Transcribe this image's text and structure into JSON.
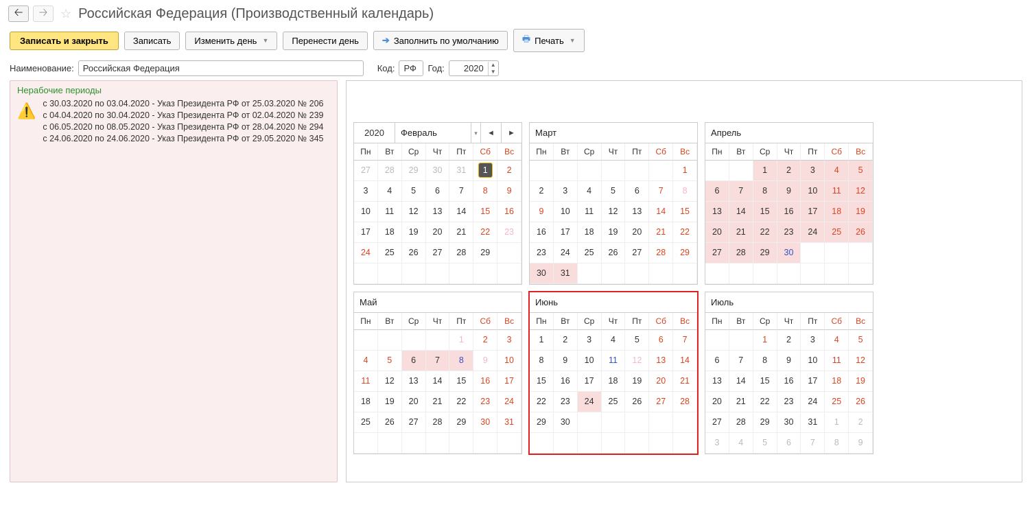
{
  "page_title": "Российская Федерация (Производственный календарь)",
  "toolbar": {
    "save_close": "Записать и закрыть",
    "save": "Записать",
    "change_day": "Изменить день",
    "move_day": "Перенести день",
    "fill_default": "Заполнить по умолчанию",
    "print": "Печать"
  },
  "form": {
    "name_label": "Наименование:",
    "name_value": "Российская Федерация",
    "code_label": "Код:",
    "code_value": "РФ",
    "year_label": "Год:",
    "year_value": "2020"
  },
  "notice": {
    "title": "Нерабочие периоды",
    "lines": [
      "с 30.03.2020 по 03.04.2020 - Указ Президента РФ от 25.03.2020 № 206",
      "с 04.04.2020 по 30.04.2020 - Указ Президента РФ от 02.04.2020 № 239",
      "с 06.05.2020 по 08.05.2020 - Указ Президента РФ от 28.04.2020 № 294",
      "с 24.06.2020 по 24.06.2020 - Указ Президента РФ от 29.05.2020 № 345"
    ]
  },
  "dow": {
    "mo": "Пн",
    "tu": "Вт",
    "we": "Ср",
    "th": "Чт",
    "fr": "Пт",
    "sa": "Сб",
    "su": "Вс"
  },
  "months": [
    {
      "year_label": "2020",
      "name": "Февраль",
      "show_nav": true,
      "cells": [
        {
          "n": "27",
          "cls": "gray"
        },
        {
          "n": "28",
          "cls": "gray"
        },
        {
          "n": "29",
          "cls": "gray"
        },
        {
          "n": "30",
          "cls": "gray"
        },
        {
          "n": "31",
          "cls": "gray"
        },
        {
          "n": "1",
          "cls": "today"
        },
        {
          "n": "2",
          "cls": "red"
        },
        {
          "n": "3"
        },
        {
          "n": "4"
        },
        {
          "n": "5"
        },
        {
          "n": "6"
        },
        {
          "n": "7"
        },
        {
          "n": "8",
          "cls": "red"
        },
        {
          "n": "9",
          "cls": "red"
        },
        {
          "n": "10"
        },
        {
          "n": "11"
        },
        {
          "n": "12"
        },
        {
          "n": "13"
        },
        {
          "n": "14"
        },
        {
          "n": "15",
          "cls": "red"
        },
        {
          "n": "16",
          "cls": "red"
        },
        {
          "n": "17"
        },
        {
          "n": "18"
        },
        {
          "n": "19"
        },
        {
          "n": "20"
        },
        {
          "n": "21"
        },
        {
          "n": "22",
          "cls": "red"
        },
        {
          "n": "23",
          "cls": "pink"
        },
        {
          "n": "24",
          "cls": "red"
        },
        {
          "n": "25"
        },
        {
          "n": "26"
        },
        {
          "n": "27"
        },
        {
          "n": "28"
        },
        {
          "n": "29"
        },
        {
          "n": ""
        },
        {
          "n": ""
        },
        {
          "n": ""
        },
        {
          "n": ""
        },
        {
          "n": ""
        },
        {
          "n": ""
        },
        {
          "n": ""
        },
        {
          "n": ""
        }
      ]
    },
    {
      "name": "Март",
      "cells": [
        {
          "n": ""
        },
        {
          "n": ""
        },
        {
          "n": ""
        },
        {
          "n": ""
        },
        {
          "n": ""
        },
        {
          "n": ""
        },
        {
          "n": "1",
          "cls": "red"
        },
        {
          "n": "2"
        },
        {
          "n": "3"
        },
        {
          "n": "4"
        },
        {
          "n": "5"
        },
        {
          "n": "6"
        },
        {
          "n": "7",
          "cls": "red"
        },
        {
          "n": "8",
          "cls": "pink"
        },
        {
          "n": "9",
          "cls": "red"
        },
        {
          "n": "10"
        },
        {
          "n": "11"
        },
        {
          "n": "12"
        },
        {
          "n": "13"
        },
        {
          "n": "14",
          "cls": "red"
        },
        {
          "n": "15",
          "cls": "red"
        },
        {
          "n": "16"
        },
        {
          "n": "17"
        },
        {
          "n": "18"
        },
        {
          "n": "19"
        },
        {
          "n": "20"
        },
        {
          "n": "21",
          "cls": "red"
        },
        {
          "n": "22",
          "cls": "red"
        },
        {
          "n": "23"
        },
        {
          "n": "24"
        },
        {
          "n": "25"
        },
        {
          "n": "26"
        },
        {
          "n": "27"
        },
        {
          "n": "28",
          "cls": "red"
        },
        {
          "n": "29",
          "cls": "red"
        },
        {
          "n": "30",
          "cls": "nw"
        },
        {
          "n": "31",
          "cls": "nw"
        },
        {
          "n": ""
        },
        {
          "n": ""
        },
        {
          "n": ""
        },
        {
          "n": ""
        },
        {
          "n": ""
        }
      ]
    },
    {
      "name": "Апрель",
      "cells": [
        {
          "n": ""
        },
        {
          "n": ""
        },
        {
          "n": "1",
          "cls": "nw"
        },
        {
          "n": "2",
          "cls": "nw"
        },
        {
          "n": "3",
          "cls": "nw"
        },
        {
          "n": "4",
          "cls": "red nw"
        },
        {
          "n": "5",
          "cls": "red nw"
        },
        {
          "n": "6",
          "cls": "nw"
        },
        {
          "n": "7",
          "cls": "nw"
        },
        {
          "n": "8",
          "cls": "nw"
        },
        {
          "n": "9",
          "cls": "nw"
        },
        {
          "n": "10",
          "cls": "nw"
        },
        {
          "n": "11",
          "cls": "red nw"
        },
        {
          "n": "12",
          "cls": "red nw"
        },
        {
          "n": "13",
          "cls": "nw"
        },
        {
          "n": "14",
          "cls": "nw"
        },
        {
          "n": "15",
          "cls": "nw"
        },
        {
          "n": "16",
          "cls": "nw"
        },
        {
          "n": "17",
          "cls": "nw"
        },
        {
          "n": "18",
          "cls": "red nw"
        },
        {
          "n": "19",
          "cls": "red nw"
        },
        {
          "n": "20",
          "cls": "nw"
        },
        {
          "n": "21",
          "cls": "nw"
        },
        {
          "n": "22",
          "cls": "nw"
        },
        {
          "n": "23",
          "cls": "nw"
        },
        {
          "n": "24",
          "cls": "nw"
        },
        {
          "n": "25",
          "cls": "red nw"
        },
        {
          "n": "26",
          "cls": "red nw"
        },
        {
          "n": "27",
          "cls": "nw"
        },
        {
          "n": "28",
          "cls": "nw"
        },
        {
          "n": "29",
          "cls": "nw"
        },
        {
          "n": "30",
          "cls": "blue nw"
        },
        {
          "n": ""
        },
        {
          "n": ""
        },
        {
          "n": ""
        },
        {
          "n": ""
        },
        {
          "n": ""
        },
        {
          "n": ""
        },
        {
          "n": ""
        },
        {
          "n": ""
        },
        {
          "n": ""
        },
        {
          "n": ""
        }
      ]
    },
    {
      "name": "Май",
      "cells": [
        {
          "n": ""
        },
        {
          "n": ""
        },
        {
          "n": ""
        },
        {
          "n": ""
        },
        {
          "n": "1",
          "cls": "pink"
        },
        {
          "n": "2",
          "cls": "red"
        },
        {
          "n": "3",
          "cls": "red"
        },
        {
          "n": "4",
          "cls": "red"
        },
        {
          "n": "5",
          "cls": "red"
        },
        {
          "n": "6",
          "cls": "nw"
        },
        {
          "n": "7",
          "cls": "nw"
        },
        {
          "n": "8",
          "cls": "blue nw"
        },
        {
          "n": "9",
          "cls": "pink"
        },
        {
          "n": "10",
          "cls": "red"
        },
        {
          "n": "11",
          "cls": "red"
        },
        {
          "n": "12"
        },
        {
          "n": "13"
        },
        {
          "n": "14"
        },
        {
          "n": "15"
        },
        {
          "n": "16",
          "cls": "red"
        },
        {
          "n": "17",
          "cls": "red"
        },
        {
          "n": "18"
        },
        {
          "n": "19"
        },
        {
          "n": "20"
        },
        {
          "n": "21"
        },
        {
          "n": "22"
        },
        {
          "n": "23",
          "cls": "red"
        },
        {
          "n": "24",
          "cls": "red"
        },
        {
          "n": "25"
        },
        {
          "n": "26"
        },
        {
          "n": "27"
        },
        {
          "n": "28"
        },
        {
          "n": "29"
        },
        {
          "n": "30",
          "cls": "red"
        },
        {
          "n": "31",
          "cls": "red"
        },
        {
          "n": ""
        },
        {
          "n": ""
        },
        {
          "n": ""
        },
        {
          "n": ""
        },
        {
          "n": ""
        },
        {
          "n": ""
        },
        {
          "n": ""
        }
      ]
    },
    {
      "name": "Июнь",
      "highlight": true,
      "cells": [
        {
          "n": "1"
        },
        {
          "n": "2"
        },
        {
          "n": "3"
        },
        {
          "n": "4"
        },
        {
          "n": "5"
        },
        {
          "n": "6",
          "cls": "red"
        },
        {
          "n": "7",
          "cls": "red"
        },
        {
          "n": "8"
        },
        {
          "n": "9"
        },
        {
          "n": "10"
        },
        {
          "n": "11",
          "cls": "blue"
        },
        {
          "n": "12",
          "cls": "pink"
        },
        {
          "n": "13",
          "cls": "red"
        },
        {
          "n": "14",
          "cls": "red"
        },
        {
          "n": "15"
        },
        {
          "n": "16"
        },
        {
          "n": "17"
        },
        {
          "n": "18"
        },
        {
          "n": "19"
        },
        {
          "n": "20",
          "cls": "red"
        },
        {
          "n": "21",
          "cls": "red"
        },
        {
          "n": "22"
        },
        {
          "n": "23"
        },
        {
          "n": "24",
          "cls": "nw"
        },
        {
          "n": "25"
        },
        {
          "n": "26"
        },
        {
          "n": "27",
          "cls": "red"
        },
        {
          "n": "28",
          "cls": "red"
        },
        {
          "n": "29"
        },
        {
          "n": "30"
        },
        {
          "n": ""
        },
        {
          "n": ""
        },
        {
          "n": ""
        },
        {
          "n": ""
        },
        {
          "n": ""
        },
        {
          "n": ""
        },
        {
          "n": ""
        },
        {
          "n": ""
        },
        {
          "n": ""
        },
        {
          "n": ""
        },
        {
          "n": ""
        },
        {
          "n": ""
        }
      ]
    },
    {
      "name": "Июль",
      "cells": [
        {
          "n": ""
        },
        {
          "n": ""
        },
        {
          "n": "1",
          "cls": "red"
        },
        {
          "n": "2"
        },
        {
          "n": "3"
        },
        {
          "n": "4",
          "cls": "red"
        },
        {
          "n": "5",
          "cls": "red"
        },
        {
          "n": "6"
        },
        {
          "n": "7"
        },
        {
          "n": "8"
        },
        {
          "n": "9"
        },
        {
          "n": "10"
        },
        {
          "n": "11",
          "cls": "red"
        },
        {
          "n": "12",
          "cls": "red"
        },
        {
          "n": "13"
        },
        {
          "n": "14"
        },
        {
          "n": "15"
        },
        {
          "n": "16"
        },
        {
          "n": "17"
        },
        {
          "n": "18",
          "cls": "red"
        },
        {
          "n": "19",
          "cls": "red"
        },
        {
          "n": "20"
        },
        {
          "n": "21"
        },
        {
          "n": "22"
        },
        {
          "n": "23"
        },
        {
          "n": "24"
        },
        {
          "n": "25",
          "cls": "red"
        },
        {
          "n": "26",
          "cls": "red"
        },
        {
          "n": "27"
        },
        {
          "n": "28"
        },
        {
          "n": "29"
        },
        {
          "n": "30"
        },
        {
          "n": "31"
        },
        {
          "n": "1",
          "cls": "gray"
        },
        {
          "n": "2",
          "cls": "gray"
        },
        {
          "n": "3",
          "cls": "gray"
        },
        {
          "n": "4",
          "cls": "gray"
        },
        {
          "n": "5",
          "cls": "gray"
        },
        {
          "n": "6",
          "cls": "gray"
        },
        {
          "n": "7",
          "cls": "gray"
        },
        {
          "n": "8",
          "cls": "gray"
        },
        {
          "n": "9",
          "cls": "gray"
        }
      ]
    }
  ]
}
